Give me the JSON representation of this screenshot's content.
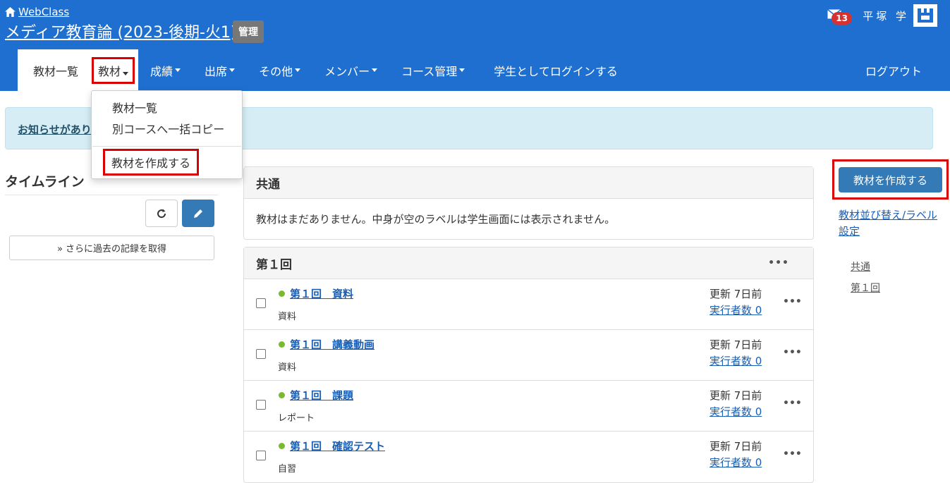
{
  "header": {
    "brand": "WebClass",
    "course_title": "メディア教育論 (2023-後期-火1)",
    "admin_badge": "管理",
    "mail_count": "13",
    "user_name": "平塚 学"
  },
  "nav": {
    "items": [
      "教材一覧",
      "教材",
      "成績",
      "出席",
      "その他",
      "メンバー",
      "コース管理",
      "学生としてログインする"
    ],
    "logout": "ログアウト"
  },
  "notice": {
    "text": "お知らせがあり"
  },
  "dropdown": {
    "items": [
      "教材一覧",
      "別コースへ一括コピー"
    ],
    "create": "教材を作成する"
  },
  "timeline": {
    "title": "タイムライン",
    "older_button": "» さらに過去の記録を取得"
  },
  "common_panel": {
    "title": "共通",
    "empty_message": "教材はまだありません。中身が空のラベルは学生画面には表示されません。"
  },
  "section": {
    "title": "第１回",
    "items": [
      {
        "title": "第１回　資料",
        "type": "資料",
        "updated": "更新 7日前",
        "runs": "実行者数 0"
      },
      {
        "title": "第１回　講義動画",
        "type": "資料",
        "updated": "更新 7日前",
        "runs": "実行者数 0"
      },
      {
        "title": "第１回　課題",
        "type": "レポート",
        "updated": "更新 7日前",
        "runs": "実行者数 0"
      },
      {
        "title": "第１回　確認テスト",
        "type": "自習",
        "updated": "更新 7日前",
        "runs": "実行者数 0"
      }
    ]
  },
  "sidebar": {
    "create_button": "教材を作成する",
    "sort_link": "教材並び替え/ラベル設定",
    "links": [
      "共通",
      "第１回"
    ]
  },
  "colors": {
    "header_bg": "#1e6fd0",
    "primary": "#337ab7",
    "highlight": "#d80000",
    "status_dot": "#7cb82f"
  }
}
